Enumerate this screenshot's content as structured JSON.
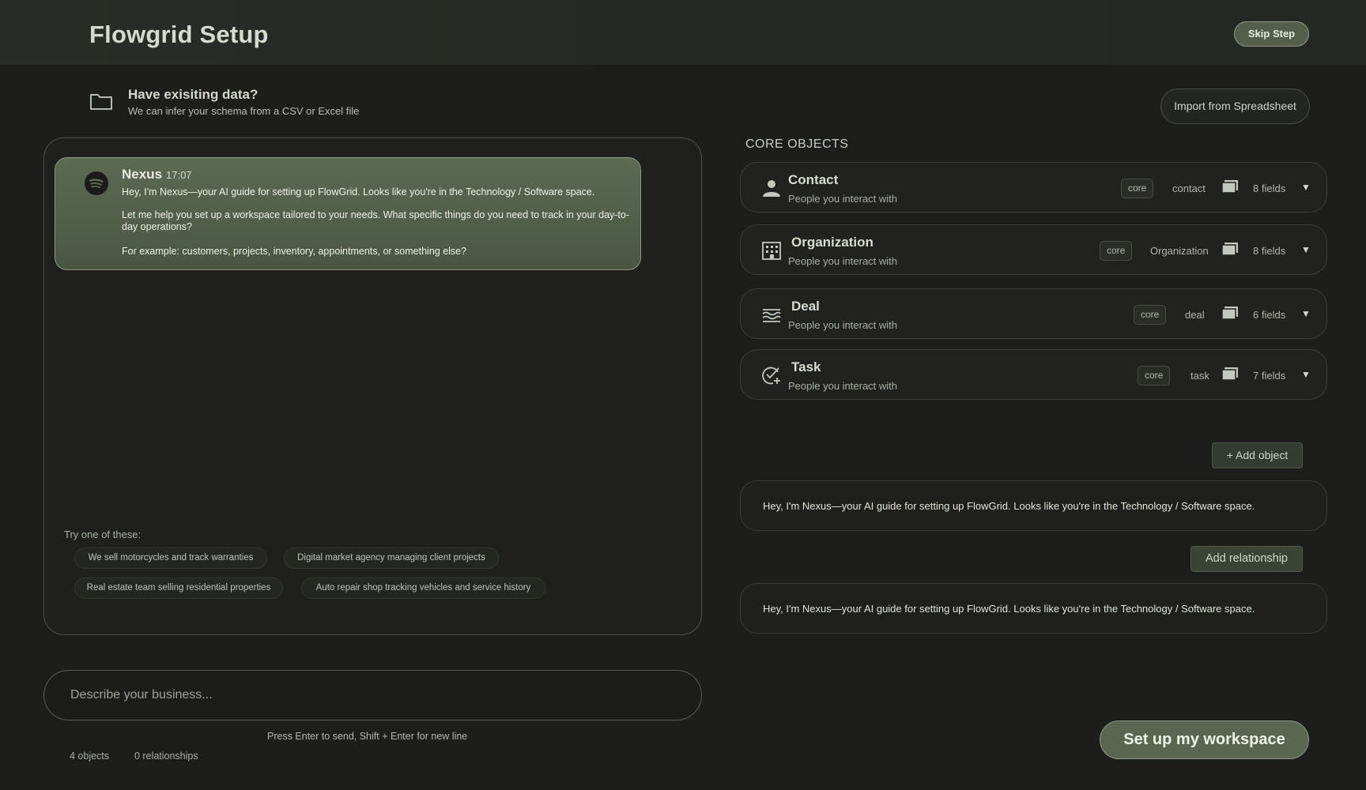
{
  "header": {
    "title": "Flowgrid Setup",
    "skip_label": "Skip Step"
  },
  "import": {
    "title": "Have exisiting data?",
    "subtitle": "We can infer your schema from a CSV or Excel file",
    "button_label": "Import from Spreadsheet",
    "icon": "folder-icon"
  },
  "chat": {
    "message": {
      "sender": "Nexus",
      "time": "17:07",
      "avatar_icon": "spotify-like-avatar",
      "line1": "Hey, I'm Nexus—your AI guide for setting up FlowGrid. Looks like you're in the Technology / Software space.",
      "line2": "Let me help you set up a workspace tailored to your needs. What specific things do you need to track in your day-to-day operations?",
      "line3": "For example: customers, projects, inventory, appointments, or something else?"
    },
    "suggestions_label": "Try one of these:",
    "suggestions": [
      "We sell motorcycles and track warranties",
      "Digital market agency managing client projects",
      "Real estate team selling residential properties",
      "Auto repair shop tracking vehicles and service history"
    ],
    "composer_placeholder": "Describe your business...",
    "hint": "Press Enter to send, Shift + Enter for new line",
    "objects_count": "4 objects",
    "relationships_count": "0 relationships"
  },
  "objects": {
    "section_title": "CORE OBJECTS",
    "items": [
      {
        "name": "Contact",
        "desc": "People you interact with",
        "badge": "core",
        "key": "contact",
        "fields": "8 fields",
        "icon": "person-icon"
      },
      {
        "name": "Organization",
        "desc": "People you interact with",
        "badge": "core",
        "key": "Organization",
        "fields": "8 fields",
        "icon": "building-icon"
      },
      {
        "name": "Deal",
        "desc": "People you interact with",
        "badge": "core",
        "key": "deal",
        "fields": "6 fields",
        "icon": "waves-icon"
      },
      {
        "name": "Task",
        "desc": "People you interact with",
        "badge": "core",
        "key": "task",
        "fields": "7 fields",
        "icon": "task-check-icon"
      }
    ],
    "add_object_label": "+ Add object",
    "info_text_1": "Hey, I'm Nexus—your AI guide for setting up FlowGrid. Looks like you're in the Technology / Software space.",
    "add_relationship_label": "Add relationship",
    "info_text_2": "Hey, I'm Nexus—your AI guide for setting up FlowGrid. Looks like you're in the Technology / Software space."
  },
  "footer": {
    "setup_label": "Set up my workspace"
  },
  "colors": {
    "background": "#1d1e1c",
    "accent": "#5a6650",
    "bubble": "#546148"
  }
}
